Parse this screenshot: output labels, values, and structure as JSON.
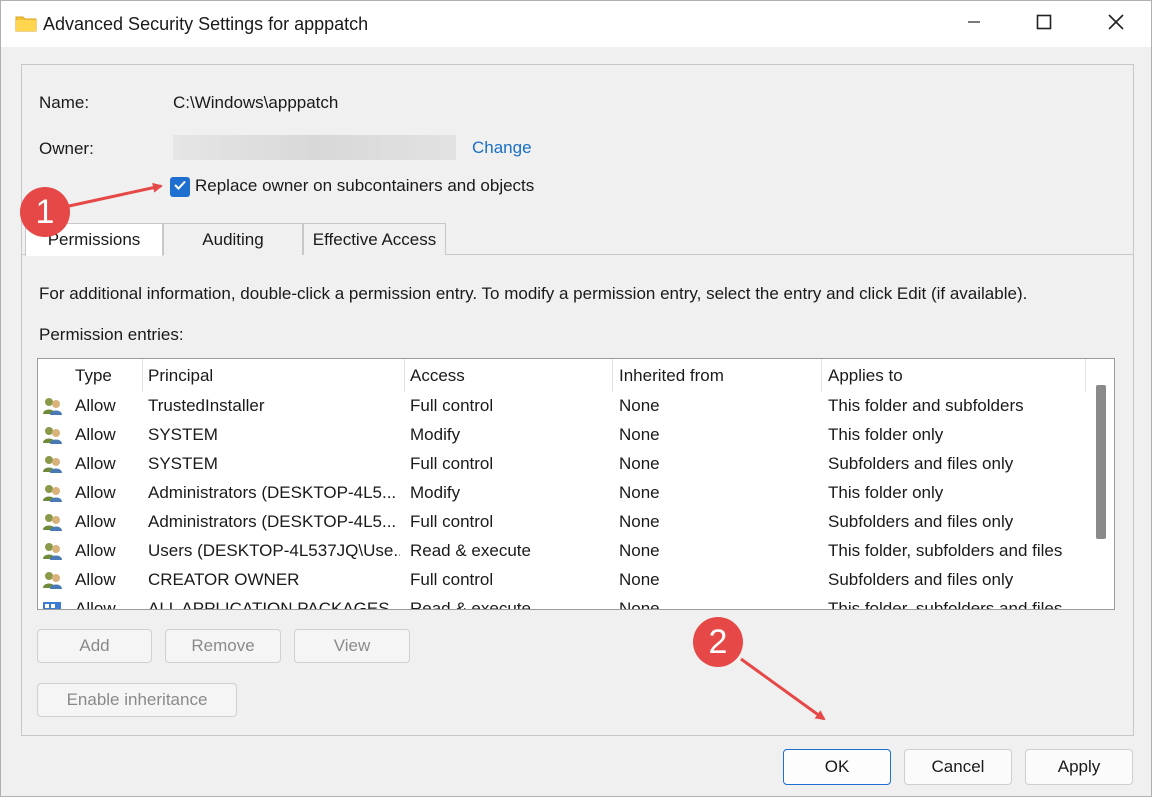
{
  "window": {
    "title": "Advanced Security Settings for apppatch",
    "icon": "folder-icon"
  },
  "info": {
    "name_label": "Name:",
    "name_value": "C:\\Windows\\apppatch",
    "owner_label": "Owner:",
    "change_link": "Change",
    "replace_owner_label": "Replace owner on subcontainers and objects",
    "replace_owner_checked": true
  },
  "tabs": [
    {
      "label": "Permissions",
      "selected": true
    },
    {
      "label": "Auditing",
      "selected": false
    },
    {
      "label": "Effective Access",
      "selected": false
    }
  ],
  "permissions": {
    "info_text": "For additional information, double-click a permission entry. To modify a permission entry, select the entry and click Edit (if available).",
    "entries_label": "Permission entries:",
    "columns": [
      "Type",
      "Principal",
      "Access",
      "Inherited from",
      "Applies to"
    ],
    "rows": [
      {
        "type": "Allow",
        "principal": "TrustedInstaller",
        "access": "Full control",
        "inherited": "None",
        "applies": "This folder and subfolders",
        "icon": "user-group-icon"
      },
      {
        "type": "Allow",
        "principal": "SYSTEM",
        "access": "Modify",
        "inherited": "None",
        "applies": "This folder only",
        "icon": "user-group-icon"
      },
      {
        "type": "Allow",
        "principal": "SYSTEM",
        "access": "Full control",
        "inherited": "None",
        "applies": "Subfolders and files only",
        "icon": "user-group-icon"
      },
      {
        "type": "Allow",
        "principal": "Administrators (DESKTOP-4L5...",
        "access": "Modify",
        "inherited": "None",
        "applies": "This folder only",
        "icon": "user-group-icon"
      },
      {
        "type": "Allow",
        "principal": "Administrators (DESKTOP-4L5...",
        "access": "Full control",
        "inherited": "None",
        "applies": "Subfolders and files only",
        "icon": "user-group-icon"
      },
      {
        "type": "Allow",
        "principal": "Users (DESKTOP-4L537JQ\\Use...",
        "access": "Read & execute",
        "inherited": "None",
        "applies": "This folder, subfolders and files",
        "icon": "user-group-icon"
      },
      {
        "type": "Allow",
        "principal": "CREATOR OWNER",
        "access": "Full control",
        "inherited": "None",
        "applies": "Subfolders and files only",
        "icon": "user-group-icon"
      },
      {
        "type": "Allow",
        "principal": "ALL APPLICATION PACKAGES",
        "access": "Read & execute",
        "inherited": "None",
        "applies": "This folder, subfolders and files",
        "icon": "app-packages-icon"
      }
    ]
  },
  "buttons": {
    "add": "Add",
    "remove": "Remove",
    "view": "View",
    "enable_inheritance": "Enable inheritance",
    "ok": "OK",
    "cancel": "Cancel",
    "apply": "Apply"
  },
  "annotations": {
    "step1": "1",
    "step2": "2",
    "color": "#e54846"
  }
}
